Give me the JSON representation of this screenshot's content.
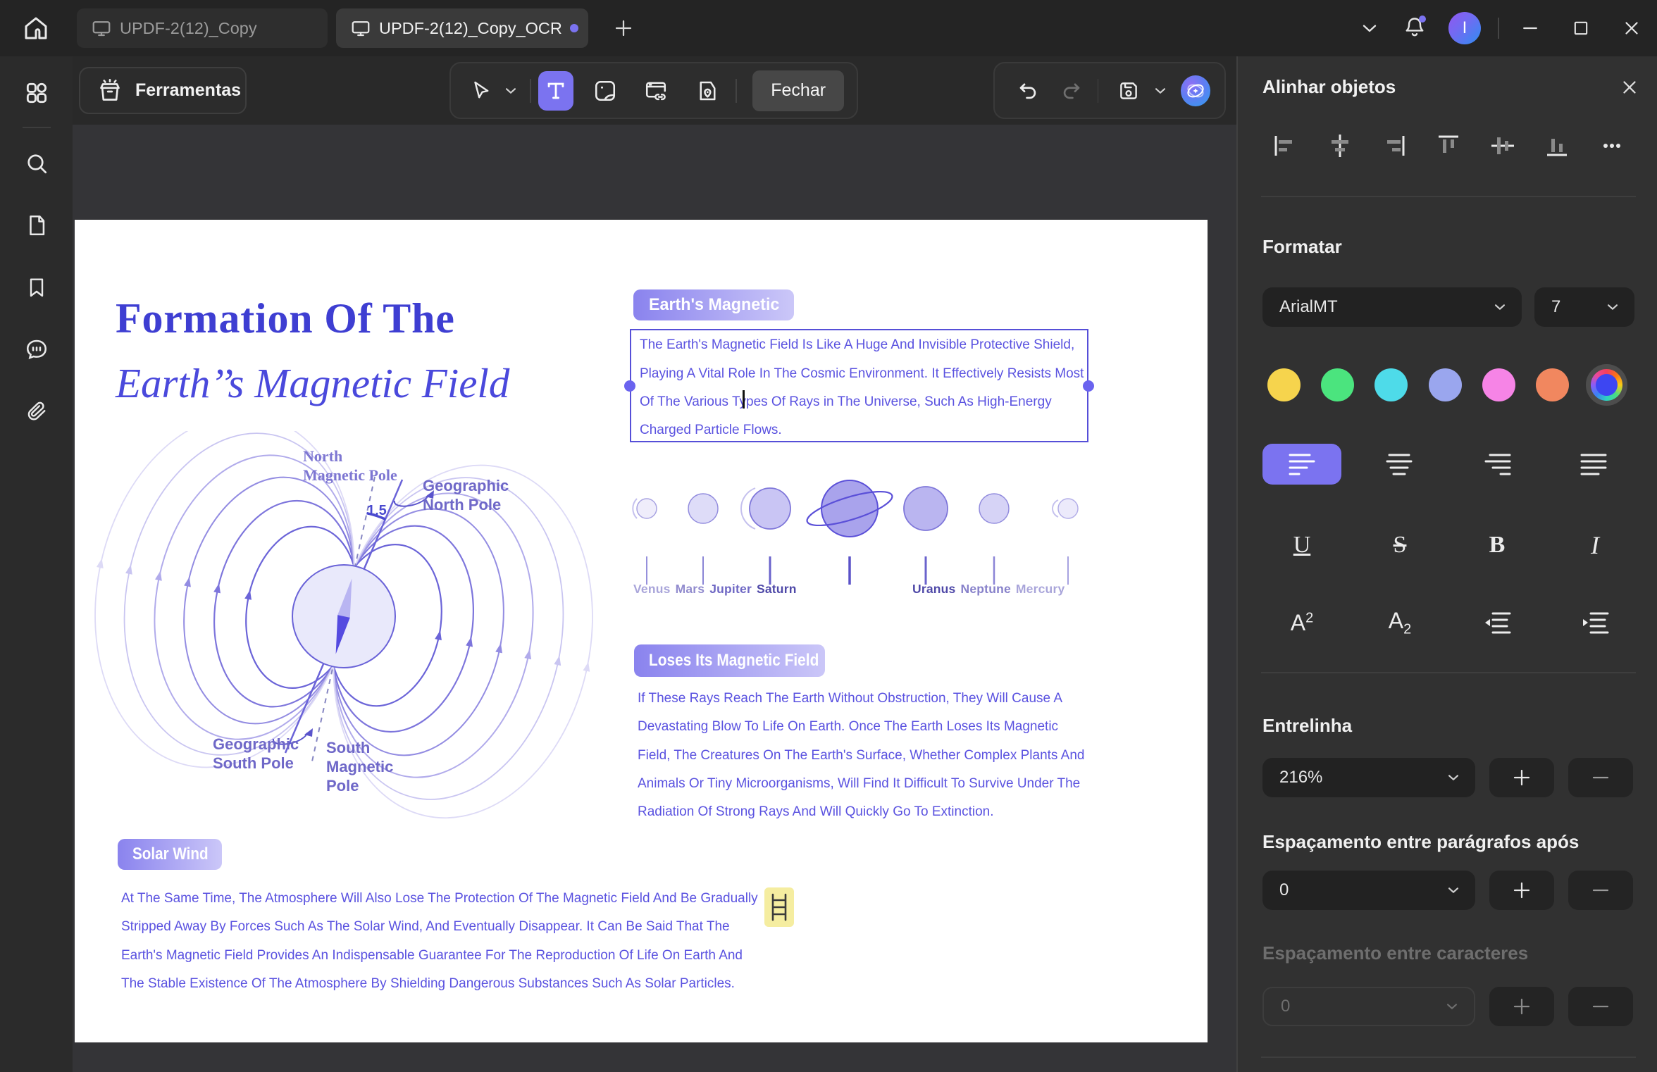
{
  "window": {
    "tabs": [
      {
        "label": "UPDF-2(12)_Copy",
        "active": false
      },
      {
        "label": "UPDF-2(12)_Copy_OCR",
        "active": true
      }
    ],
    "avatar_letter": "I"
  },
  "toolbar": {
    "tools_button_label": "Ferramentas",
    "close_edit_label": "Fechar"
  },
  "panel": {
    "title": "Alinhar objetos",
    "format_heading": "Formatar",
    "font_family": "ArialMT",
    "font_size": "7",
    "line_spacing_label": "Entrelinha",
    "line_spacing_value": "216%",
    "paragraph_spacing_label": "Espaçamento entre parágrafos após",
    "paragraph_spacing_value": "0",
    "char_spacing_label": "Espaçamento entre caracteres",
    "char_spacing_value": "0",
    "accent_color": "#7b73f0",
    "swatch_colors": [
      "#f6d44d",
      "#4be47e",
      "#4edbe9",
      "#9aa6ee",
      "#f684e6",
      "#f1875f"
    ]
  },
  "document": {
    "title_line1": "Formation Of The",
    "title_line2": "Earth’’s Magnetic Field",
    "diagram": {
      "north_magnetic_pole": "North\nMagnetic Pole",
      "geographic_north_pole": "Geographic\nNorth Pole",
      "angle_value": "1.5",
      "geographic_south_pole": "Geographic\nSouth Pole",
      "south_magnetic_pole": "South\nMagnetic\nPole"
    },
    "textbox": {
      "pill": "Earth's Magnetic",
      "lines": [
        "The Earth's Magnetic Field Is Like A Huge And Invisible Protective Shield,",
        "Playing A Vital Role In The Cosmic Environment. It Effectively Resists Most",
        "Of The Various Types Of Rays in The Universe, Such As High-Energy",
        "Charged Particle Flows."
      ]
    },
    "planets": {
      "names": [
        "Venus",
        "Mars",
        "Jupiter",
        "Saturn",
        "Uranus",
        "Neptune",
        "Mercury"
      ]
    },
    "section2": {
      "pill": "Loses Its Magnetic Field",
      "lines": [
        "If These Rays Reach The Earth Without Obstruction, They Will Cause A",
        "Devastating Blow To Life On Earth. Once The Earth Loses Its Magnetic",
        "Field, The Creatures On The Earth's Surface, Whether Complex Plants And",
        "Animals Or Tiny Microorganisms, Will Find It Difficult To Survive Under The",
        "Radiation Of Strong Rays And Will Quickly Go To Extinction."
      ]
    },
    "section3": {
      "pill": "Solar Wind",
      "lines": [
        "At The Same Time, The Atmosphere Will Also Lose The Protection Of The Magnetic Field And Be Gradually",
        "Stripped Away By Forces Such As The Solar Wind, And Eventually Disappear. It Can Be Said That The",
        "Earth's Magnetic Field Provides An Indispensable Guarantee For The Reproduction Of Life On Earth And",
        "The Stable Existence Of The Atmosphere By Shielding Dangerous Substances Such As Solar Particles."
      ]
    }
  }
}
